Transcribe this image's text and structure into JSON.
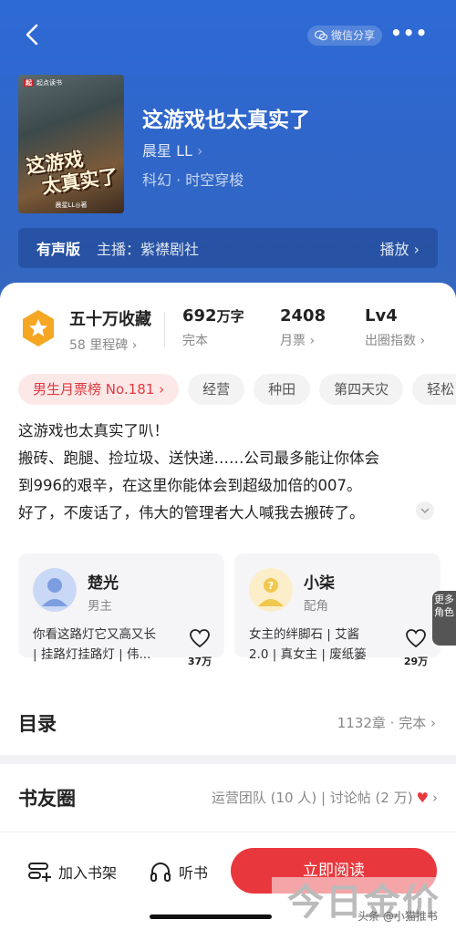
{
  "header": {
    "share_label": "微信分享",
    "more_label": "•••"
  },
  "book": {
    "cover_brand": "起点读书",
    "cover_title_line1": "这游戏",
    "cover_title_line2": "太真实了",
    "cover_author": "晨星LL◎著",
    "title": "这游戏也太真实了",
    "author": "晨星 LL",
    "genre": "科幻 · 时空穿梭"
  },
  "audio": {
    "label": "有声版",
    "host": "主播：紫襟剧社",
    "play": "播放"
  },
  "stats": {
    "favorites": "五十万收藏",
    "milestone": "58 里程碑",
    "words": "692",
    "words_unit": "万字",
    "status": "完本",
    "tickets": "2408",
    "tickets_label": "月票",
    "level": "Lv4",
    "level_label": "出圈指数"
  },
  "tags": [
    "男生月票榜 No.181",
    "经营",
    "种田",
    "第四天灾",
    "轻松"
  ],
  "synopsis": [
    "这游戏也太真实了叭！",
    "搬砖、跑腿、捡垃圾、送快递……公司最多能让你体会",
    "到996的艰辛，在这里你能体会到超级加倍的007。",
    "好了，不废话了，伟大的管理者大人喊我去搬砖了。"
  ],
  "characters": [
    {
      "name": "楚光",
      "role": "男主",
      "desc_line1": "你看这路灯它又高又长",
      "desc_line2": "| 挂路灯挂路灯 | 伟...",
      "likes": "37万"
    },
    {
      "name": "小柒",
      "role": "配角",
      "desc_line1": "女主的绊脚石 | 艾酱",
      "desc_line2": "2.0 | 真女主 | 废纸篓",
      "likes": "29万"
    }
  ],
  "more_roles": "更多角色",
  "toc": {
    "title": "目录",
    "info": "1132章 · 完本"
  },
  "circle": {
    "title": "书友圈",
    "info": "运营团队 (10 人) | 讨论帖 (2 万)"
  },
  "bottom": {
    "shelf": "加入书架",
    "listen": "听书",
    "read": "立即阅读"
  },
  "watermark": {
    "big": "今日金价",
    "small": "头条 @小猫推书"
  },
  "colors": {
    "hero_blue": "#2f66c9",
    "accent_red": "#e8383d",
    "medal_orange": "#f5a623"
  }
}
